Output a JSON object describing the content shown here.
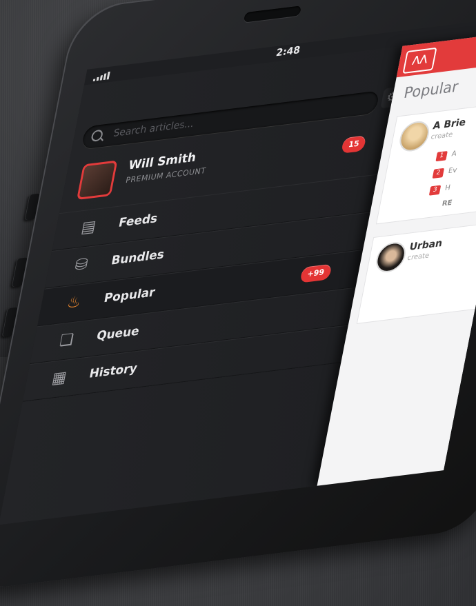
{
  "status": {
    "time": "2:48"
  },
  "search": {
    "placeholder": "Search articles..."
  },
  "profile": {
    "name": "Will Smith",
    "account": "PREMIUM ACCOUNT",
    "badge": "15"
  },
  "menu": [
    {
      "label": "Feeds",
      "icon": "newspaper-icon"
    },
    {
      "label": "Bundles",
      "icon": "database-icon"
    },
    {
      "label": "Popular",
      "icon": "flame-icon",
      "badge": "+99"
    },
    {
      "label": "Queue",
      "icon": "layers-icon"
    },
    {
      "label": "History",
      "icon": "calendar-icon"
    }
  ],
  "content": {
    "title": "Popular",
    "cards": [
      {
        "title": "A Brie",
        "sub": "create",
        "items": [
          {
            "n": "1",
            "t": "A"
          },
          {
            "n": "2",
            "t": "Ev"
          },
          {
            "n": "3",
            "t": "H"
          }
        ],
        "footer": "RE"
      },
      {
        "title": "Urban",
        "sub": "create"
      }
    ]
  },
  "colors": {
    "accent": "#e23b3b",
    "menu_bg": "#232427",
    "content_bg": "#f4f4f5"
  }
}
